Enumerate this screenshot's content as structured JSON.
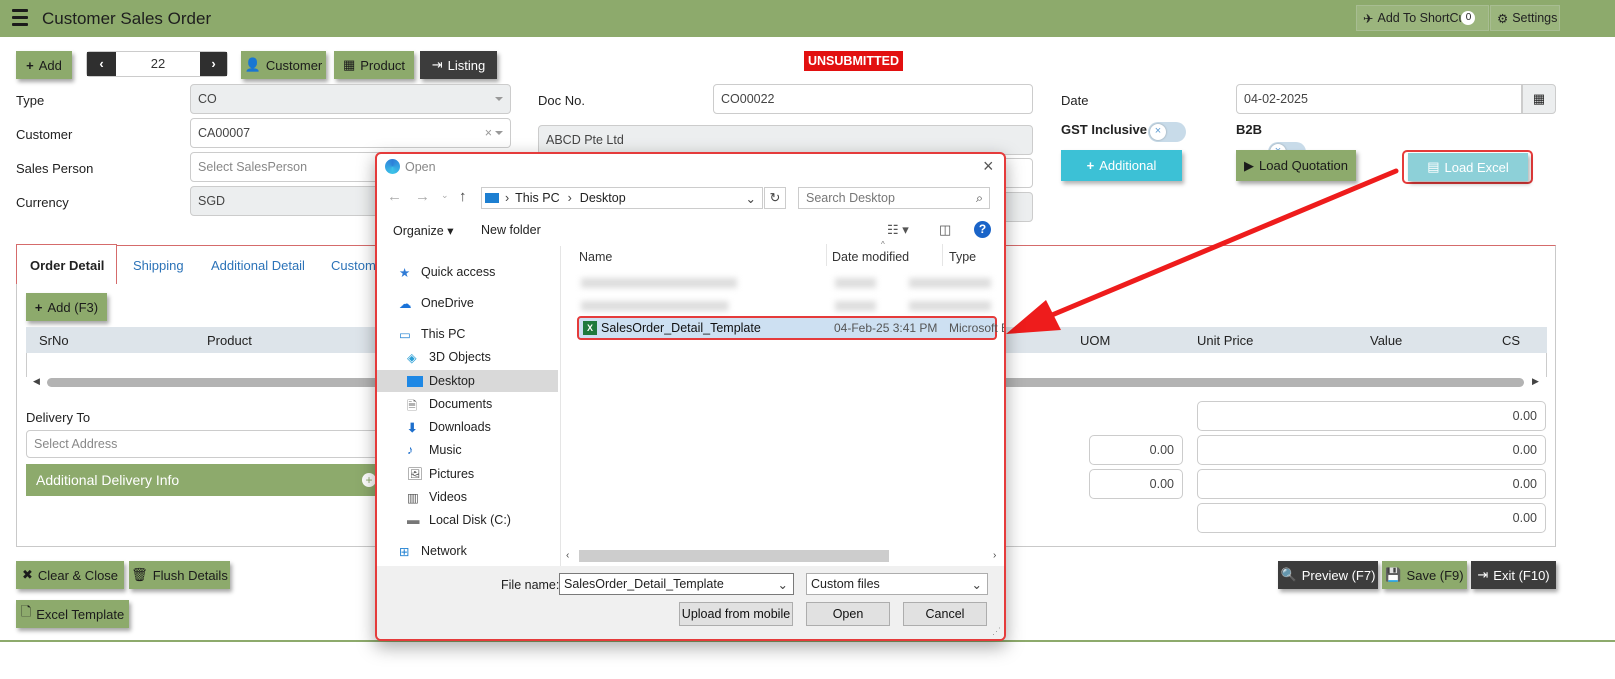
{
  "header": {
    "title": "Customer Sales Order",
    "shortcut_label": "Add To ShortCut",
    "shortcut_count": "0",
    "settings_label": "Settings"
  },
  "toolbar": {
    "add_label": "Add",
    "record_no": "22",
    "customer_label": "Customer",
    "product_label": "Product",
    "listing_label": "Listing",
    "status": "UNSUBMITTED"
  },
  "form": {
    "type_label": "Type",
    "type_value": "CO",
    "customer_label": "Customer",
    "customer_value": "CA00007",
    "salesperson_label": "Sales Person",
    "salesperson_placeholder": "Select SalesPerson",
    "currency_label": "Currency",
    "currency_value": "SGD",
    "docno_label": "Doc No.",
    "docno_value": "CO00022",
    "customer_name": "ABCD Pte Ltd",
    "date_label": "Date",
    "date_value": "04-02-2025",
    "gst_label": "GST Inclusive",
    "b2b_label": "B2B",
    "additional_label": "Additional",
    "load_quotation_label": "Load Quotation",
    "load_excel_label": "Load Excel"
  },
  "tabs": [
    "Order Detail",
    "Shipping",
    "Additional Detail",
    "Custom"
  ],
  "detail": {
    "add_label": "Add (F3)",
    "columns": [
      "SrNo",
      "Product",
      "UOM",
      "Unit Price",
      "Value",
      "CS"
    ],
    "delivery_label": "Delivery To",
    "address_placeholder": "Select Address",
    "additional_delivery": "Additional Delivery Info",
    "totals": [
      "0.00",
      "0.00",
      "0.00",
      "0.00",
      "0.00",
      "0.00"
    ]
  },
  "footer": {
    "clear_label": "Clear & Close",
    "flush_label": "Flush Details",
    "excel_template_label": "Excel Template",
    "preview_label": "Preview (F7)",
    "save_label": "Save (F9)",
    "exit_label": "Exit (F10)"
  },
  "dialog": {
    "title": "Open",
    "path": [
      "This PC",
      "Desktop"
    ],
    "search_placeholder": "Search Desktop",
    "organize_label": "Organize",
    "new_folder_label": "New folder",
    "sidebar": [
      "Quick access",
      "OneDrive",
      "This PC",
      "3D Objects",
      "Desktop",
      "Documents",
      "Downloads",
      "Music",
      "Pictures",
      "Videos",
      "Local Disk (C:)",
      "Network"
    ],
    "columns": [
      "Name",
      "Date modified",
      "Type"
    ],
    "file": {
      "name": "SalesOrder_Detail_Template",
      "date": "04-Feb-25 3:41 PM",
      "type": "Microsoft E"
    },
    "filename_label": "File name:",
    "filename_value": "SalesOrder_Detail_Template",
    "filetype_value": "Custom files",
    "upload_label": "Upload from mobile",
    "open_label": "Open",
    "cancel_label": "Cancel"
  },
  "colors": {
    "green": "#8daa6c",
    "cyan": "#3cc1d6",
    "red": "#e53b3b",
    "status_red": "#e21010",
    "dark": "#3c3c3c"
  }
}
